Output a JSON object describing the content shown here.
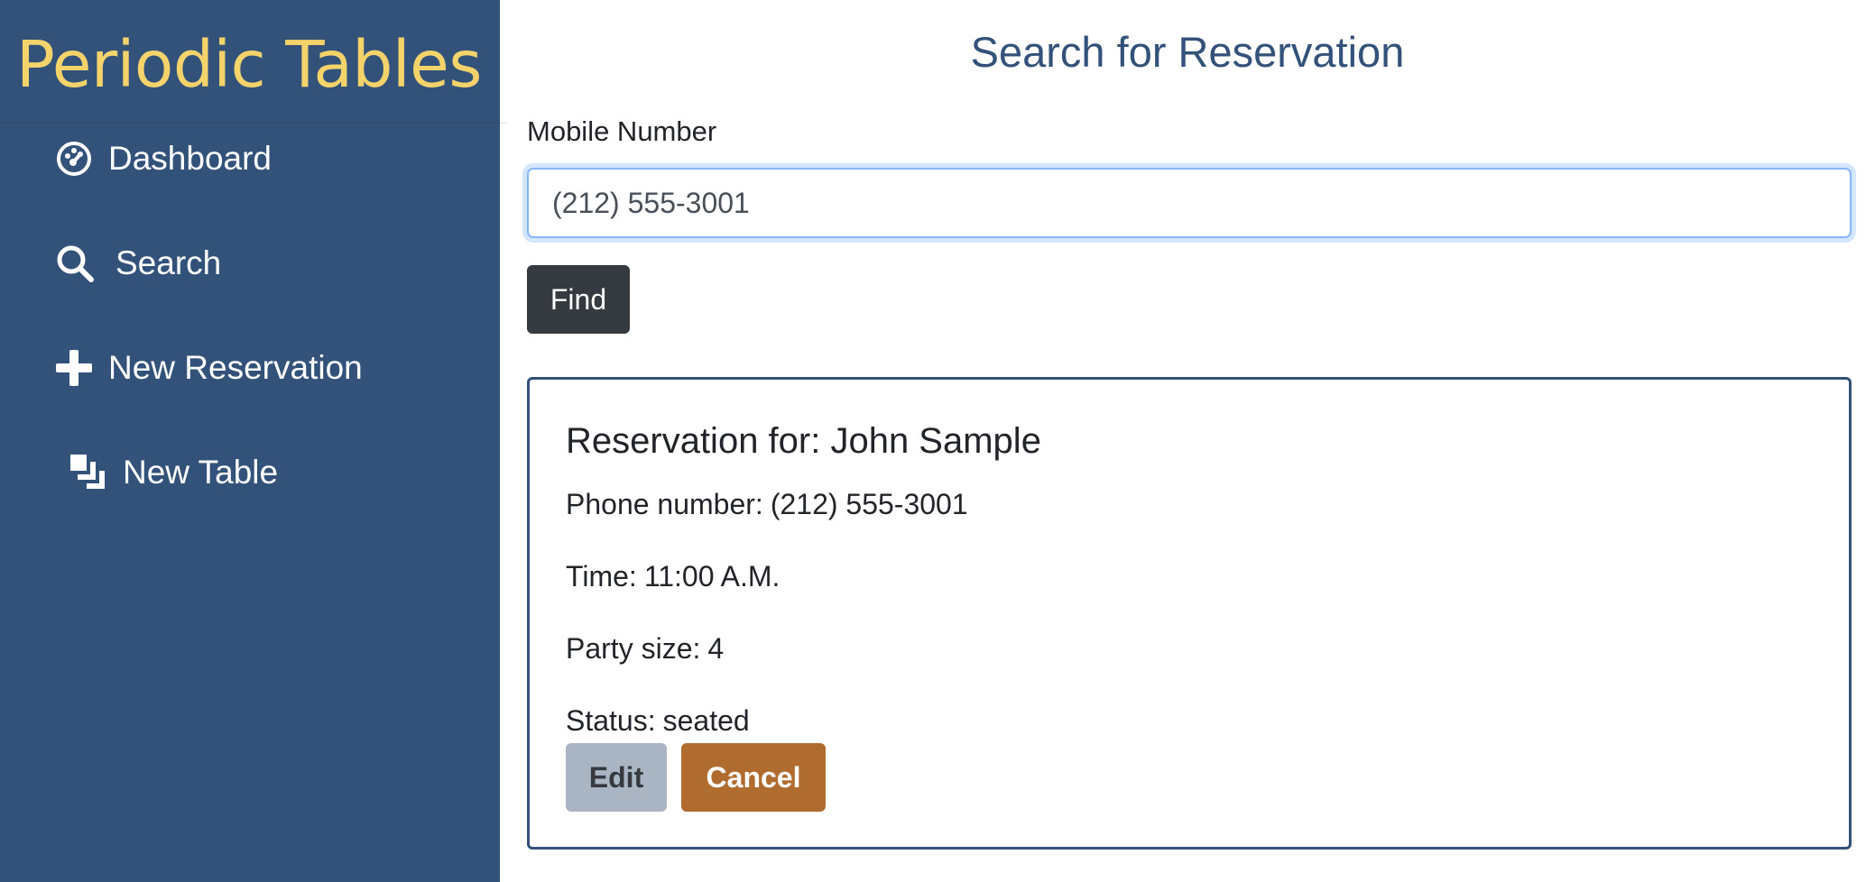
{
  "app": {
    "title": "Periodic Tables"
  },
  "sidebar": {
    "items": [
      {
        "label": "Dashboard",
        "icon": "dashboard-icon"
      },
      {
        "label": "Search",
        "icon": "search-icon"
      },
      {
        "label": "New Reservation",
        "icon": "plus-icon"
      },
      {
        "label": "New Table",
        "icon": "layers-icon"
      }
    ]
  },
  "main": {
    "title": "Search for Reservation",
    "search": {
      "label": "Mobile Number",
      "value": "(212) 555-3001",
      "find_label": "Find"
    },
    "reservation": {
      "title": "Reservation for: John Sample",
      "phone_label": "Phone number:",
      "phone": "(212) 555-3001",
      "time_label": "Time:",
      "time": "11:00 A.M.",
      "party_label": "Party size:",
      "party_size": "4",
      "status_label": "Status:",
      "status": "seated",
      "edit_label": "Edit",
      "cancel_label": "Cancel"
    }
  },
  "colors": {
    "sidebar_bg": "#33527a",
    "brand": "#f5d36b",
    "title": "#33527a",
    "find_button": "#343a40",
    "edit_button": "#aab5c4",
    "cancel_button": "#b06c2f"
  }
}
